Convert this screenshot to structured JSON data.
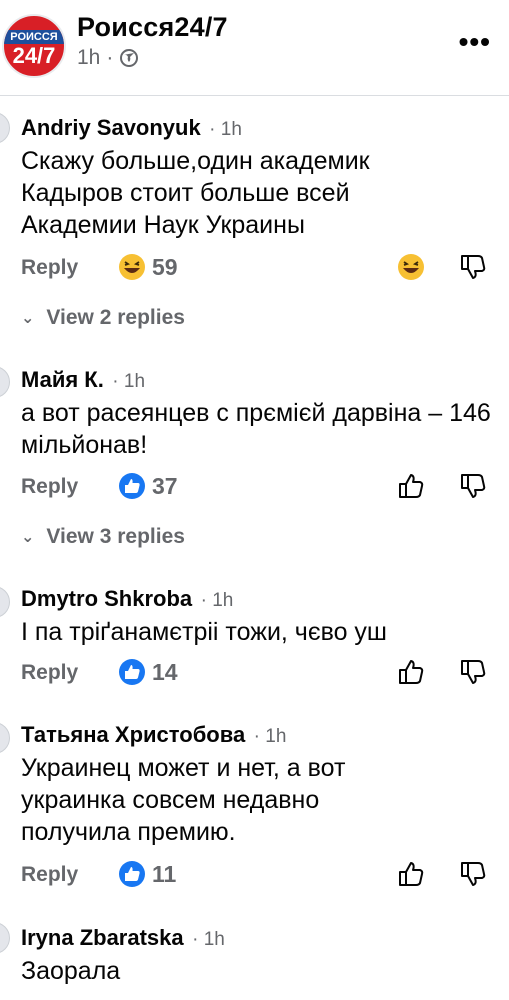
{
  "post": {
    "page_name": "Роисся24/7",
    "time": "1h",
    "logo": {
      "top": "РОИССЯ",
      "big": "24/7"
    }
  },
  "comments": [
    {
      "author": "Andriy Savonyuk",
      "time": "1h",
      "text": "Скажу больше,один академик Кадыров стоит больше всей Академии Наук Украины",
      "reaction_icon": "haha-emoji",
      "reaction_count": "59",
      "reply_label": "Reply",
      "view_replies": "View 2 replies"
    },
    {
      "author": "Майя К.",
      "time": "1h",
      "text": "а вот расеянцев с прємієй дарвіна – 146 мільйонав!",
      "reaction_icon": "like-emoji",
      "reaction_count": "37",
      "reply_label": "Reply",
      "view_replies": "View 3 replies"
    },
    {
      "author": "Dmytro Shkroba",
      "time": "1h",
      "text": "І па тріґанамєтріі тожи, чєво уш",
      "reaction_icon": "like-emoji",
      "reaction_count": "14",
      "reply_label": "Reply"
    },
    {
      "author": "Татьяна Христобова",
      "time": "1h",
      "text": "Украинец может и нет, а вот украинка совсем недавно получила премию.",
      "reaction_icon": "like-emoji",
      "reaction_count": "11",
      "reply_label": "Reply"
    },
    {
      "author": "Iryna Zbaratska",
      "time": "1h",
      "text": "Заорала"
    }
  ],
  "colors": {
    "like_blue": "#1877f2",
    "haha_yellow": "#f7c033",
    "muted_text": "#65676b"
  }
}
